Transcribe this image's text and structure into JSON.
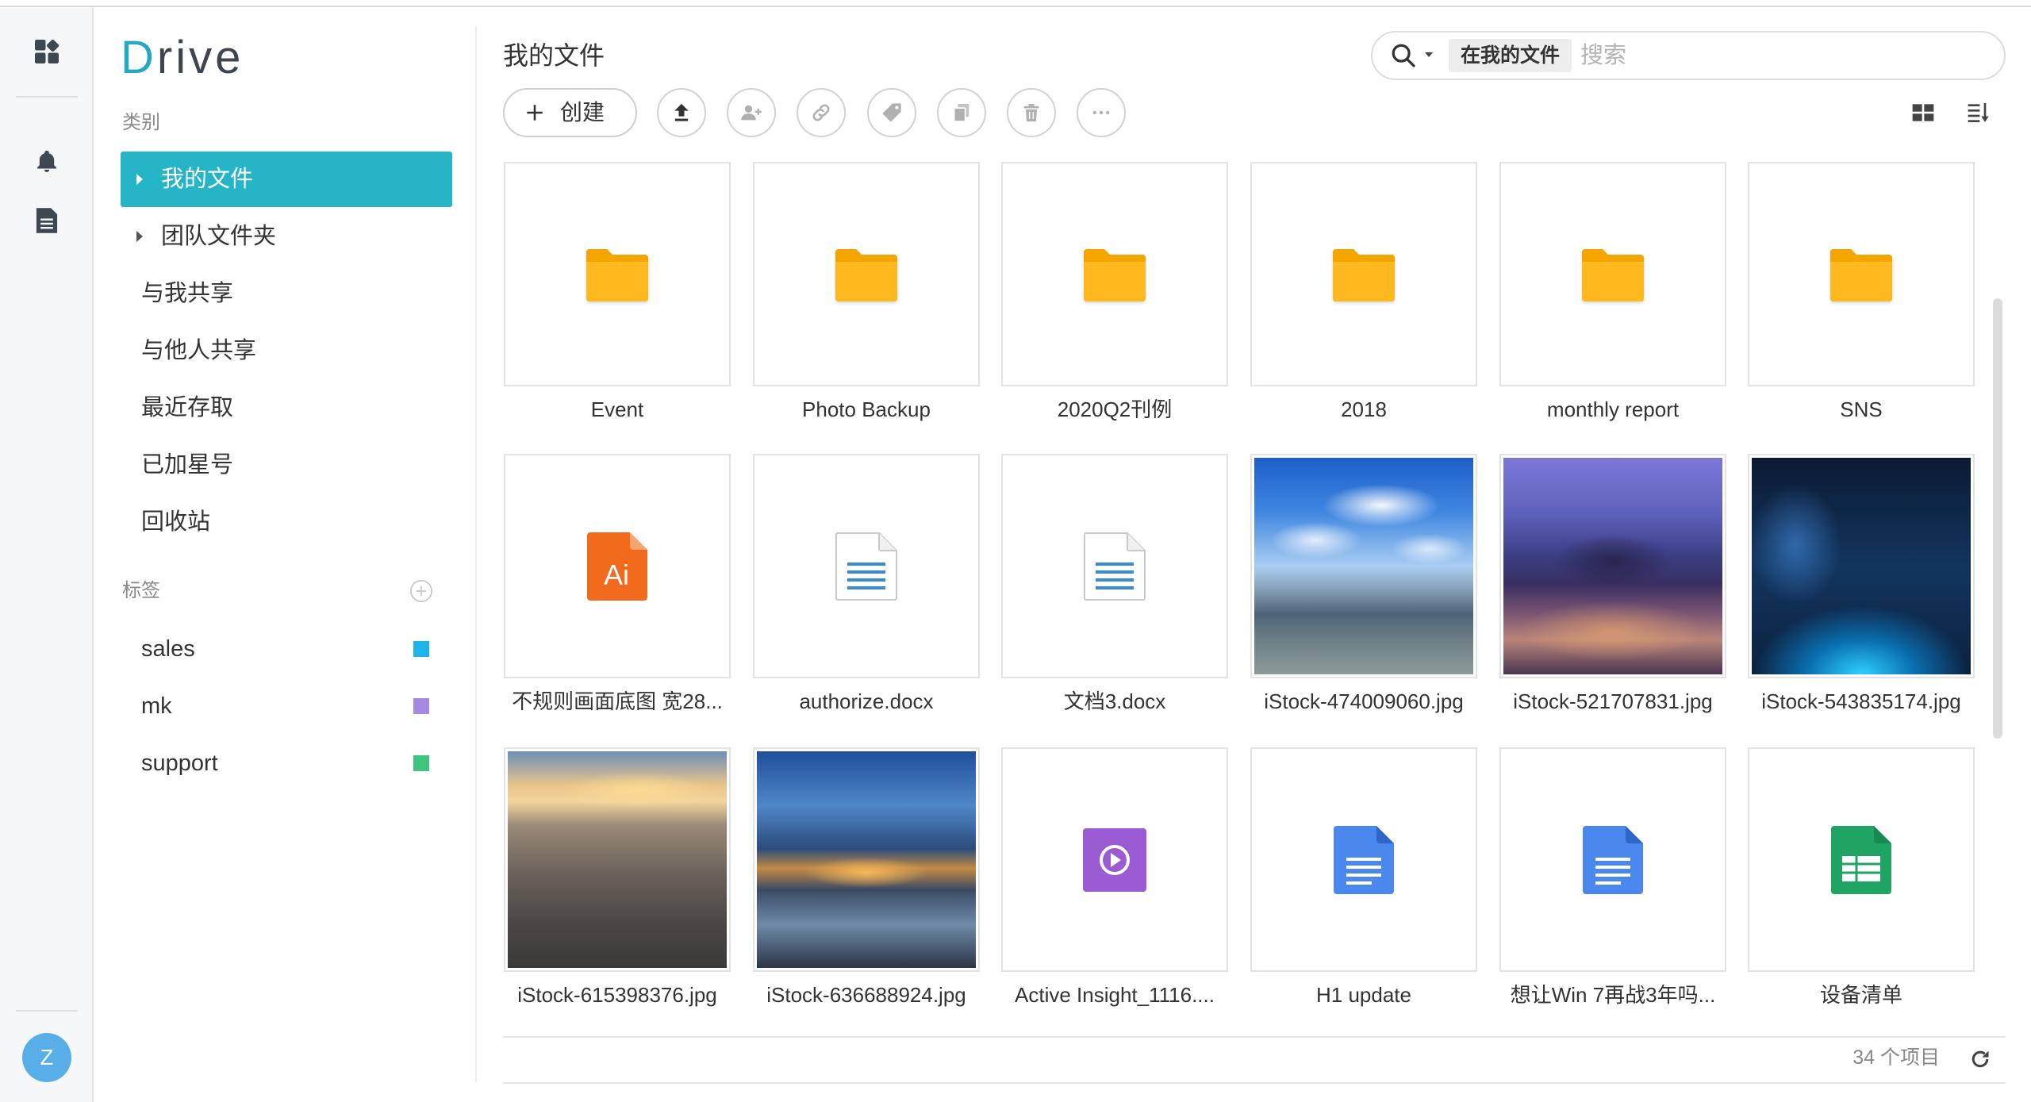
{
  "rail": {
    "top_icon": "dashboard-icon",
    "icons": [
      "bell-icon",
      "document-icon"
    ],
    "avatar_letter": "Z",
    "avatar_color": "#5aaee8"
  },
  "sidebar": {
    "logo": {
      "first": "D",
      "rest": "rive",
      "accent_color": "#26a8c0"
    },
    "category_heading": "类别",
    "nav": [
      {
        "label": "我的文件",
        "selected": true,
        "expandable": true
      },
      {
        "label": "团队文件夹",
        "selected": false,
        "expandable": true
      },
      {
        "label": "与我共享",
        "selected": false,
        "expandable": false
      },
      {
        "label": "与他人共享",
        "selected": false,
        "expandable": false
      },
      {
        "label": "最近存取",
        "selected": false,
        "expandable": false
      },
      {
        "label": "已加星号",
        "selected": false,
        "expandable": false
      },
      {
        "label": "回收站",
        "selected": false,
        "expandable": false
      }
    ],
    "tags_heading": "标签",
    "add_tag_icon": "plus-circle-icon",
    "tags": [
      {
        "label": "sales",
        "color": "#1eb4ea"
      },
      {
        "label": "mk",
        "color": "#a38be3"
      },
      {
        "label": "support",
        "color": "#3ec47d"
      }
    ]
  },
  "main": {
    "title": "我的文件",
    "search": {
      "icon": "search-icon",
      "scope": "在我的文件",
      "placeholder": "搜索"
    },
    "toolbar": {
      "create": {
        "icon": "plus-icon",
        "label": "创建"
      },
      "buttons": [
        "upload-icon",
        "share-user-icon",
        "link-icon",
        "tag-icon",
        "copy-icon",
        "delete-icon",
        "more-icon"
      ],
      "view_icons": [
        "grid-view-icon",
        "sort-icon"
      ]
    },
    "files": [
      {
        "name": "Event",
        "icon": "folder-icon"
      },
      {
        "name": "Photo Backup",
        "icon": "folder-icon"
      },
      {
        "name": "2020Q2刊例",
        "icon": "folder-icon"
      },
      {
        "name": "2018",
        "icon": "folder-icon"
      },
      {
        "name": "monthly report",
        "icon": "folder-icon"
      },
      {
        "name": "SNS",
        "icon": "folder-icon"
      },
      {
        "name": "不规则画面底图 宽28...",
        "icon": "illustrator-file-icon",
        "badge": "Ai"
      },
      {
        "name": "authorize.docx",
        "icon": "word-file-icon"
      },
      {
        "name": "文档3.docx",
        "icon": "word-file-icon"
      },
      {
        "name": "iStock-474009060.jpg",
        "icon": "image-file-icon"
      },
      {
        "name": "iStock-521707831.jpg",
        "icon": "image-file-icon"
      },
      {
        "name": "iStock-543835174.jpg",
        "icon": "image-file-icon"
      },
      {
        "name": "iStock-615398376.jpg",
        "icon": "image-file-icon"
      },
      {
        "name": "iStock-636688924.jpg",
        "icon": "image-file-icon"
      },
      {
        "name": "Active Insight_1116....",
        "icon": "video-file-icon"
      },
      {
        "name": "H1 update",
        "icon": "doc-file-icon"
      },
      {
        "name": "想让Win 7再战3年吗...",
        "icon": "doc-file-icon"
      },
      {
        "name": "设备清单",
        "icon": "sheet-file-icon"
      }
    ],
    "footer": {
      "item_count": "34 个项目",
      "refresh_icon": "refresh-icon"
    }
  },
  "colors": {
    "accent": "#26b4c7",
    "folder": "#ffb31a",
    "illustrator": "#f26a1b",
    "word_lines": "#3a8ad6",
    "video": "#9b5bd3",
    "document": "#4a88ee",
    "spreadsheet": "#1fa463"
  }
}
